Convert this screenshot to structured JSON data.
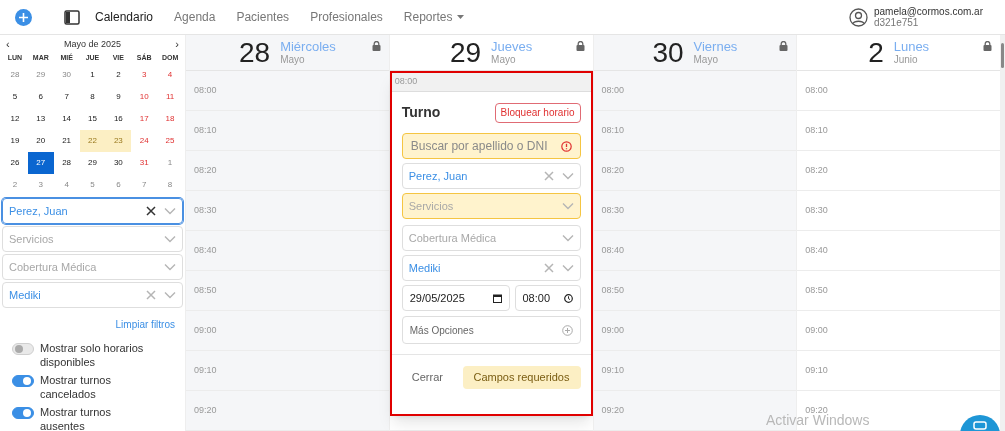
{
  "nav": {
    "items": [
      {
        "label": "Calendario",
        "selected": true,
        "dropdown": false
      },
      {
        "label": "Agenda",
        "selected": false,
        "dropdown": false
      },
      {
        "label": "Pacientes",
        "selected": false,
        "dropdown": false
      },
      {
        "label": "Profesionales",
        "selected": false,
        "dropdown": false
      },
      {
        "label": "Reportes",
        "selected": false,
        "dropdown": true
      }
    ],
    "user": {
      "email": "pamela@cormos.com.ar",
      "id": "d321e751"
    }
  },
  "mini_calendar": {
    "title": "Mayo de 2025",
    "prev": "‹",
    "next": "›",
    "weekdays": [
      "LUN",
      "MAR",
      "MIÉ",
      "JUE",
      "VIE",
      "SÁB",
      "DOM"
    ],
    "weeks": [
      [
        {
          "day": "28",
          "kind": "other",
          "highlighted": false,
          "selected": false
        },
        {
          "day": "29",
          "kind": "other",
          "highlighted": false,
          "selected": false
        },
        {
          "day": "30",
          "kind": "other",
          "highlighted": false,
          "selected": false
        },
        {
          "day": "1",
          "kind": "weekday",
          "highlighted": false,
          "selected": false
        },
        {
          "day": "2",
          "kind": "weekday",
          "highlighted": false,
          "selected": false
        },
        {
          "day": "3",
          "kind": "weekend",
          "highlighted": false,
          "selected": false
        },
        {
          "day": "4",
          "kind": "weekend",
          "highlighted": false,
          "selected": false
        }
      ],
      [
        {
          "day": "5",
          "kind": "weekday",
          "highlighted": false,
          "selected": false
        },
        {
          "day": "6",
          "kind": "weekday",
          "highlighted": false,
          "selected": false
        },
        {
          "day": "7",
          "kind": "weekday",
          "highlighted": false,
          "selected": false
        },
        {
          "day": "8",
          "kind": "weekday",
          "highlighted": false,
          "selected": false
        },
        {
          "day": "9",
          "kind": "weekday",
          "highlighted": false,
          "selected": false
        },
        {
          "day": "10",
          "kind": "weekend",
          "highlighted": false,
          "selected": false
        },
        {
          "day": "11",
          "kind": "weekend",
          "highlighted": false,
          "selected": false
        }
      ],
      [
        {
          "day": "12",
          "kind": "weekday",
          "highlighted": false,
          "selected": false
        },
        {
          "day": "13",
          "kind": "weekday",
          "highlighted": false,
          "selected": false
        },
        {
          "day": "14",
          "kind": "weekday",
          "highlighted": false,
          "selected": false
        },
        {
          "day": "15",
          "kind": "weekday",
          "highlighted": false,
          "selected": false
        },
        {
          "day": "16",
          "kind": "weekday",
          "highlighted": false,
          "selected": false
        },
        {
          "day": "17",
          "kind": "weekend",
          "highlighted": false,
          "selected": false
        },
        {
          "day": "18",
          "kind": "weekend",
          "highlighted": false,
          "selected": false
        }
      ],
      [
        {
          "day": "19",
          "kind": "weekday",
          "highlighted": false,
          "selected": false
        },
        {
          "day": "20",
          "kind": "weekday",
          "highlighted": false,
          "selected": false
        },
        {
          "day": "21",
          "kind": "weekday",
          "highlighted": false,
          "selected": false
        },
        {
          "day": "22",
          "kind": "weekday",
          "highlighted": true,
          "selected": false
        },
        {
          "day": "23",
          "kind": "weekday",
          "highlighted": true,
          "selected": false
        },
        {
          "day": "24",
          "kind": "weekend",
          "highlighted": false,
          "selected": false
        },
        {
          "day": "25",
          "kind": "weekend",
          "highlighted": false,
          "selected": false
        }
      ],
      [
        {
          "day": "26",
          "kind": "weekday",
          "highlighted": false,
          "selected": false
        },
        {
          "day": "27",
          "kind": "weekday",
          "highlighted": false,
          "selected": true
        },
        {
          "day": "28",
          "kind": "weekday",
          "highlighted": false,
          "selected": false
        },
        {
          "day": "29",
          "kind": "weekday",
          "highlighted": false,
          "selected": false
        },
        {
          "day": "30",
          "kind": "weekday",
          "highlighted": false,
          "selected": false
        },
        {
          "day": "31",
          "kind": "weekend",
          "highlighted": false,
          "selected": false
        },
        {
          "day": "1",
          "kind": "other",
          "highlighted": false,
          "selected": false
        }
      ],
      [
        {
          "day": "2",
          "kind": "other",
          "highlighted": false,
          "selected": false
        },
        {
          "day": "3",
          "kind": "other",
          "highlighted": false,
          "selected": false
        },
        {
          "day": "4",
          "kind": "other",
          "highlighted": false,
          "selected": false
        },
        {
          "day": "5",
          "kind": "other",
          "highlighted": false,
          "selected": false
        },
        {
          "day": "6",
          "kind": "other",
          "highlighted": false,
          "selected": false
        },
        {
          "day": "7",
          "kind": "other",
          "highlighted": false,
          "selected": false
        },
        {
          "day": "8",
          "kind": "other",
          "highlighted": false,
          "selected": false
        }
      ]
    ]
  },
  "filters": [
    {
      "value": "Perez, Juan",
      "clearable": true,
      "focused": true
    },
    {
      "placeholder": "Servicios",
      "clearable": false,
      "focused": false
    },
    {
      "placeholder": "Cobertura Médica",
      "clearable": false,
      "focused": false
    },
    {
      "value": "Mediki",
      "clearable": true,
      "focused": false
    }
  ],
  "clear_filters": "Limpiar filtros",
  "toggles": [
    {
      "label": "Mostrar solo horarios disponibles",
      "on": false
    },
    {
      "label": "Mostrar turnos cancelados",
      "on": true
    },
    {
      "label": "Mostrar turnos ausentes",
      "on": true
    }
  ],
  "days": [
    {
      "number": "28",
      "weekday": "Miércoles",
      "month": "Mayo",
      "locked": true,
      "shaded": true,
      "times": [
        "08:00",
        "08:10",
        "08:20",
        "08:30",
        "08:40",
        "08:50",
        "09:00",
        "09:10",
        "09:20"
      ]
    },
    {
      "number": "29",
      "weekday": "Jueves",
      "month": "Mayo",
      "locked": true,
      "shaded": false
    },
    {
      "number": "30",
      "weekday": "Viernes",
      "month": "Mayo",
      "locked": true,
      "shaded": true,
      "times": [
        "08:00",
        "08:10",
        "08:20",
        "08:30",
        "08:40",
        "08:50",
        "09:00",
        "09:10",
        "09:20"
      ]
    },
    {
      "number": "2",
      "weekday": "Lunes",
      "month": "Junio",
      "locked": true,
      "shaded": false,
      "times": [
        "08:00",
        "08:10",
        "08:20",
        "08:30",
        "08:40",
        "08:50",
        "09:00",
        "09:10",
        "09:20"
      ]
    }
  ],
  "appointment_popup": {
    "slot_time": "08:00",
    "title": "Turno",
    "block_button": "Bloquear horario",
    "search": {
      "placeholder": "Buscar por apellido o DNI",
      "error": true
    },
    "selects": [
      {
        "value": "Perez, Juan",
        "clearable": true,
        "warning": false
      },
      {
        "placeholder": "Servicios",
        "clearable": false,
        "warning": true
      },
      {
        "placeholder": "Cobertura Médica",
        "clearable": false,
        "warning": false
      },
      {
        "value": "Mediki",
        "clearable": true,
        "warning": false
      }
    ],
    "date": "29/05/2025",
    "time": "08:00",
    "more_options": "Más Opciones",
    "close_button": "Cerrar",
    "submit_button": "Campos requeridos"
  },
  "os_notice": "Activar Windows"
}
